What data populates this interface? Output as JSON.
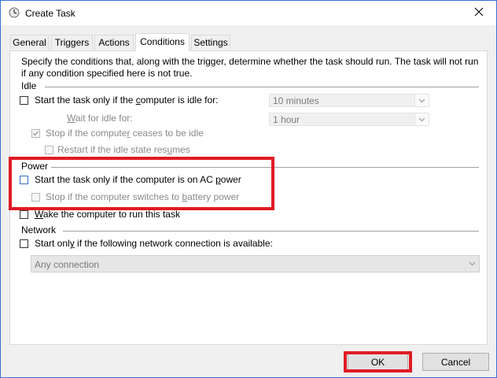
{
  "window": {
    "title": "Create Task"
  },
  "tabs": [
    {
      "label": "General"
    },
    {
      "label": "Triggers"
    },
    {
      "label": "Actions"
    },
    {
      "label": "Conditions",
      "active": true
    },
    {
      "label": "Settings"
    }
  ],
  "conditions": {
    "description": "Specify the conditions that, along with the trigger, determine whether the task should run.  The task will not run  if any condition specified here is not true.",
    "idle": {
      "heading": "Idle",
      "start_if_idle": {
        "label_pre": "Start the task only if the ",
        "label_u": "c",
        "label_post": "omputer is idle for:",
        "checked": false
      },
      "idle_duration": {
        "value": "10 minutes"
      },
      "wait_for_idle": {
        "label_u": "W",
        "label_post": "ait for idle for:"
      },
      "wait_duration": {
        "value": "1 hour"
      },
      "stop_if_not_idle": {
        "label_pre": "Stop if the compute",
        "label_u": "r",
        "label_post": " ceases to be idle",
        "checked": true,
        "disabled": true
      },
      "restart_if_idle": {
        "label_pre": "Restart if the idle state res",
        "label_u": "u",
        "label_post": "mes",
        "checked": false,
        "disabled": true
      }
    },
    "power": {
      "heading": "Power",
      "start_on_ac": {
        "label_pre": "Start the task only if the computer is on AC ",
        "label_u": "p",
        "label_post": "ower",
        "checked": false
      },
      "stop_on_battery": {
        "label_pre": "Stop if the computer switches to ",
        "label_u": "b",
        "label_post": "attery power",
        "checked": false,
        "disabled": true
      },
      "wake_to_run": {
        "label_u": "W",
        "label_post": "ake the computer to run this task",
        "checked": false
      }
    },
    "network": {
      "heading": "Network",
      "start_if_network": {
        "label_pre": "Start onl",
        "label_u": "y",
        "label_post": " if the following network connection is available:",
        "checked": false
      },
      "connection": {
        "value": "Any connection"
      }
    }
  },
  "buttons": {
    "ok": "OK",
    "cancel": "Cancel"
  },
  "colors": {
    "highlight_red": "#e01b24",
    "window_border": "#3a6fd4"
  }
}
